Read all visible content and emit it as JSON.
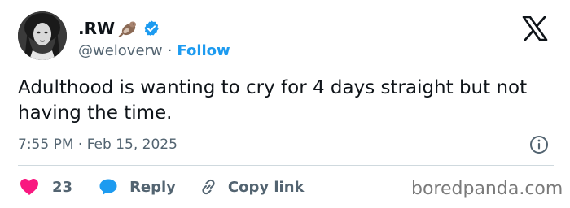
{
  "user": {
    "display_name": ".RW",
    "handle": "@weloverw",
    "separator": "·",
    "follow_label": "Follow"
  },
  "tweet": {
    "text": "Adulthood is wanting to cry for 4 days straight but not having the time.",
    "timestamp": "7:55 PM · Feb 15, 2025"
  },
  "actions": {
    "like_count": "23",
    "reply_label": "Reply",
    "copy_link_label": "Copy link"
  },
  "icons": {
    "logo": "x-logo-icon",
    "verified": "verified-badge-icon",
    "info": "info-icon",
    "like": "heart-icon",
    "reply": "speech-bubble-icon",
    "copy": "link-icon"
  },
  "colors": {
    "accent": "#1d9bf0",
    "like": "#f91880",
    "text": "#0f1419",
    "muted": "#536471",
    "divider": "#cfd9de"
  },
  "watermark": "boredpanda.com"
}
